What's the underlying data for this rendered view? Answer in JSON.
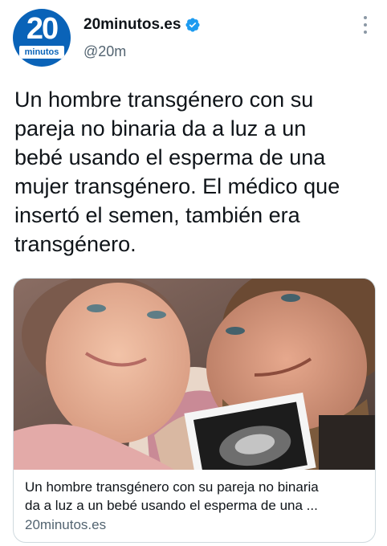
{
  "account": {
    "avatar_number": "20",
    "avatar_word": "minutos",
    "name": "20minutos.es",
    "handle": "@20m"
  },
  "tweet": {
    "text": "Un hombre transgénero con su\npareja no binaria da a luz a un\nbebé usando el esperma de una\nmujer transgénero. El médico que\ninsertó el semen, también era\ntransgénero."
  },
  "card": {
    "title": "Un hombre transgénero con su pareja no binaria\nda a luz a un bebé usando el esperma de una ...",
    "domain": "20minutos.es"
  },
  "colors": {
    "avatar_bg": "#0a63b8",
    "verified": "#1d9bf0",
    "secondary_text": "#536471",
    "border": "#cfd9de"
  },
  "icons": [
    "verified-badge-icon",
    "more-options-icon"
  ]
}
